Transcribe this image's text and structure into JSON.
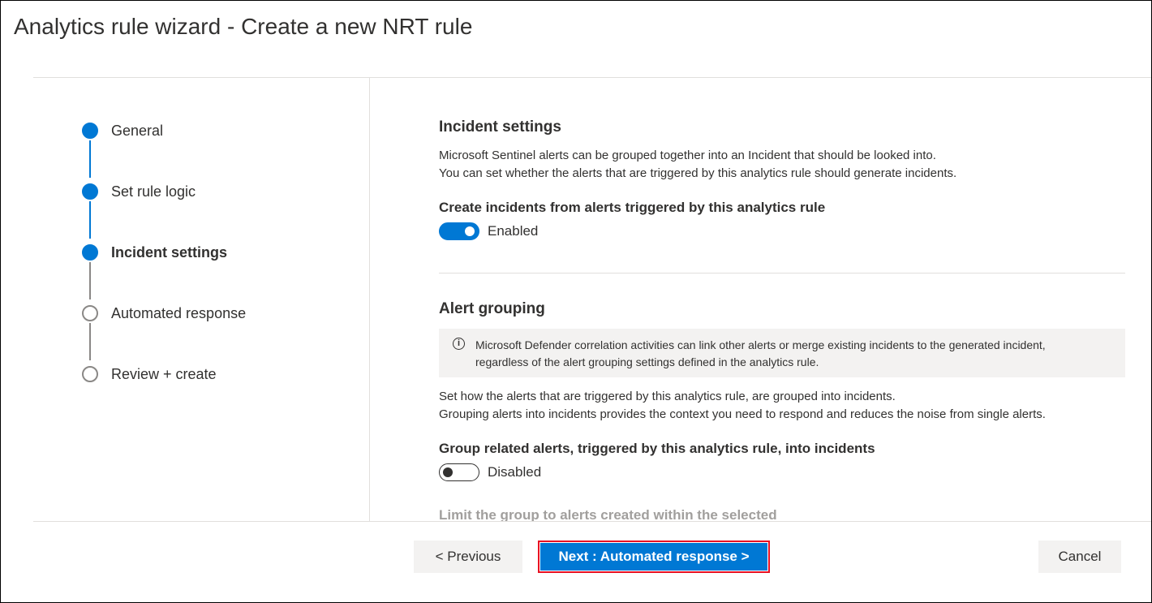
{
  "page": {
    "title": "Analytics rule wizard - Create a new NRT rule"
  },
  "steps": [
    {
      "label": "General",
      "status": "done"
    },
    {
      "label": "Set rule logic",
      "status": "done"
    },
    {
      "label": "Incident settings",
      "status": "current"
    },
    {
      "label": "Automated response",
      "status": "todo"
    },
    {
      "label": "Review + create",
      "status": "todo"
    }
  ],
  "incident_settings": {
    "heading": "Incident settings",
    "description_line1": "Microsoft Sentinel alerts can be grouped together into an Incident that should be looked into.",
    "description_line2": "You can set whether the alerts that are triggered by this analytics rule should generate incidents.",
    "create_incidents_label": "Create incidents from alerts triggered by this analytics rule",
    "create_incidents_state": "Enabled",
    "create_incidents_on": true
  },
  "alert_grouping": {
    "heading": "Alert grouping",
    "info_line1": "Microsoft Defender correlation activities can link other alerts or merge existing incidents to the generated incident,",
    "info_line2": "regardless of the alert grouping settings defined in the analytics rule.",
    "info_icon": "info-icon",
    "description_line1": "Set how the alerts that are triggered by this analytics rule, are grouped into incidents.",
    "description_line2": "Grouping alerts into incidents provides the context you need to respond and reduces the noise from single alerts.",
    "group_label": "Group related alerts, triggered by this analytics rule, into incidents",
    "group_state": "Disabled",
    "group_on": false,
    "limit_label": "Limit the group to alerts created within the selected"
  },
  "footer": {
    "previous_label": "< Previous",
    "next_label": "Next : Automated response >",
    "cancel_label": "Cancel"
  },
  "colors": {
    "accent": "#0078d4",
    "highlight_border": "#e81123",
    "button_gray": "#f3f2f1"
  }
}
